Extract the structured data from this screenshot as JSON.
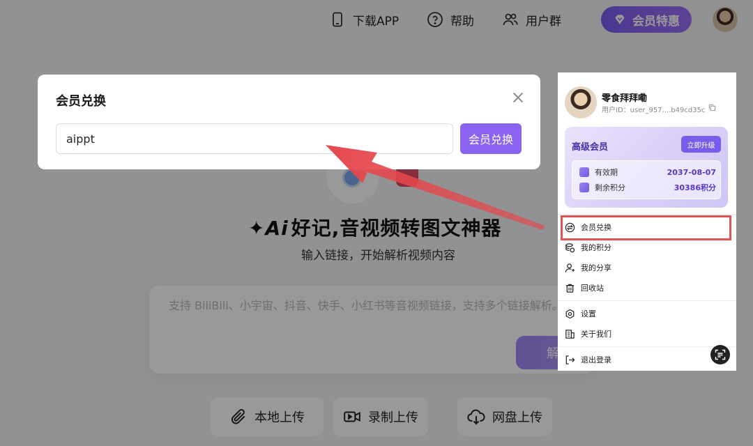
{
  "topbar": {
    "download_app": "下载APP",
    "help": "帮助",
    "user_group": "用户群",
    "vip_offer": "会员特惠"
  },
  "hero": {
    "title_ai": "Ai",
    "title_text": "好记,音视频转图文神器",
    "subtitle": "输入链接，开始解析视频内容",
    "placeholder": "支持 BiliBili、小宇宙、抖音、快手、小红书等音视频链接，支持多个链接解析。",
    "parse_button": "解"
  },
  "uploads": [
    {
      "label": "本地上传",
      "icon": "paperclip-icon"
    },
    {
      "label": "录制上传",
      "icon": "video-record-icon"
    },
    {
      "label": "网盘上传",
      "icon": "cloud-download-icon"
    }
  ],
  "modal": {
    "title": "会员兑换",
    "input_value": "aippt",
    "redeem_button": "会员兑换"
  },
  "user_panel": {
    "name": "零食拜拜嘞",
    "user_id": "用户ID：user_957....b49cd35c",
    "membership": {
      "tier": "高级会员",
      "upgrade_button": "立即升级",
      "validity_label": "有效期",
      "validity_value": "2037-08-07",
      "points_label": "剩余积分",
      "points_value": "30386积分"
    },
    "menu": [
      {
        "label": "会员兑换",
        "icon": "exchange-icon"
      },
      {
        "label": "我的积分",
        "icon": "coins-icon"
      },
      {
        "label": "我的分享",
        "icon": "share-user-icon"
      },
      {
        "label": "回收站",
        "icon": "trash-icon"
      },
      {
        "label": "设置",
        "icon": "settings-icon"
      },
      {
        "label": "关于我们",
        "icon": "building-icon"
      },
      {
        "label": "退出登录",
        "icon": "logout-icon"
      }
    ]
  },
  "colors": {
    "accent": "#8a63f0",
    "highlight_box": "#e05552",
    "arrow": "#e5484d"
  }
}
